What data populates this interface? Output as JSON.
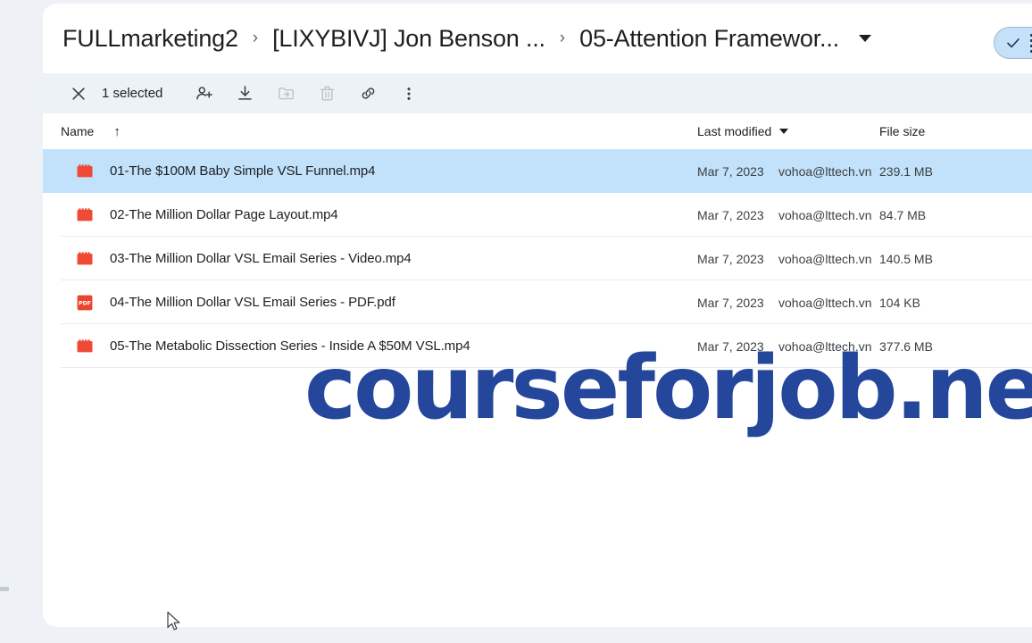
{
  "breadcrumb": {
    "items": [
      {
        "label": "FULLmarketing2"
      },
      {
        "label": "[LIXYBIVJ] Jon Benson ..."
      },
      {
        "label": "05-Attention Framewor..."
      }
    ],
    "separator": "›"
  },
  "view_toggle": {
    "check_icon": "check-icon",
    "list_icon": "list-view-icon"
  },
  "toolbar": {
    "close_icon": "close-icon",
    "selected_label": "1 selected",
    "actions": [
      {
        "name": "share-add-person-button",
        "icon": "person-add-icon",
        "disabled": false
      },
      {
        "name": "download-button",
        "icon": "download-icon",
        "disabled": false
      },
      {
        "name": "move-to-folder-button",
        "icon": "move-folder-icon",
        "disabled": true
      },
      {
        "name": "delete-button",
        "icon": "trash-icon",
        "disabled": true
      },
      {
        "name": "copy-link-button",
        "icon": "link-icon",
        "disabled": false
      },
      {
        "name": "more-options-button",
        "icon": "more-vertical-icon",
        "disabled": false
      }
    ]
  },
  "columns": {
    "name": "Name",
    "sort_arrow": "↑",
    "last_modified": "Last modified",
    "file_size": "File size"
  },
  "files": [
    {
      "name": "01-The $100M Baby Simple VSL Funnel.mp4",
      "icon": "video-file-icon",
      "modified": "Mar 7, 2023",
      "owner": "vohoa@lttech.vn",
      "size": "239.1 MB",
      "selected": true
    },
    {
      "name": "02-The Million Dollar Page Layout.mp4",
      "icon": "video-file-icon",
      "modified": "Mar 7, 2023",
      "owner": "vohoa@lttech.vn",
      "size": "84.7 MB",
      "selected": false
    },
    {
      "name": "03-The Million Dollar VSL Email Series - Video.mp4",
      "icon": "video-file-icon",
      "modified": "Mar 7, 2023",
      "owner": "vohoa@lttech.vn",
      "size": "140.5 MB",
      "selected": false
    },
    {
      "name": "04-The Million Dollar VSL Email Series - PDF.pdf",
      "icon": "pdf-file-icon",
      "modified": "Mar 7, 2023",
      "owner": "vohoa@lttech.vn",
      "size": "104 KB",
      "selected": false
    },
    {
      "name": "05-The Metabolic Dissection Series - Inside A $50M VSL.mp4",
      "icon": "video-file-icon",
      "modified": "Mar 7, 2023",
      "owner": "vohoa@lttech.vn",
      "size": "377.6 MB",
      "selected": false
    }
  ],
  "watermark": {
    "text": "courseforjob.net"
  },
  "colors": {
    "selection_blue": "#c2e2fb",
    "toolbar_bg": "#ecf2f5",
    "page_bg": "#eef2f6",
    "video_icon_red": "#ef4a35",
    "pdf_icon_red": "#e8452c",
    "watermark_blue": "#24479c",
    "toggle_pill_blue": "#c5e1f9"
  }
}
